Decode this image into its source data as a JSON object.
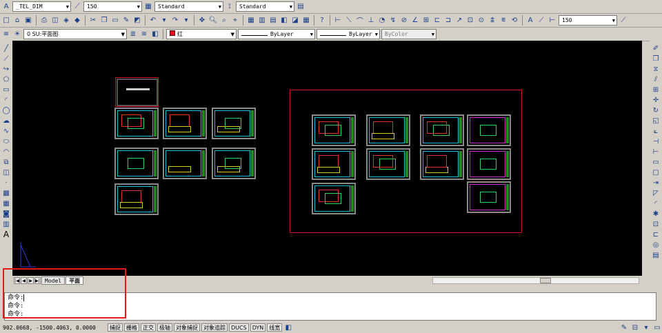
{
  "toolbar1": {
    "dimstyle": "_TEL_DIM",
    "scale": "150",
    "textstyle": "Standard",
    "tablestyle": "Standard"
  },
  "toolbar2": {
    "scale": "150"
  },
  "toolbar3": {
    "layer": "0  SU:平面图",
    "color": "红",
    "linetype": "ByLayer",
    "lineweight": "ByLayer",
    "plotstyle": "ByColor"
  },
  "tabs": {
    "model": "Model",
    "layout": "平面"
  },
  "command": {
    "lines": [
      "命令:",
      "命令:",
      "命令:"
    ]
  },
  "status": {
    "coords": "902.0668,  -1500.4063, 0.0000",
    "buttons": [
      "捕捉",
      "栅格",
      "正交",
      "极轴",
      "对象捕捉",
      "对象追踪",
      "DUCS",
      "DYN",
      "线宽"
    ]
  },
  "colors": {
    "accent": "#e21a1a",
    "canvas": "#000000",
    "frame": "#d01020"
  },
  "icons": {
    "draw": [
      "line-icon",
      "xline-icon",
      "pline-icon",
      "polygon-icon",
      "rectangle-icon",
      "arc-icon",
      "circle-icon",
      "revcloud-icon",
      "spline-icon",
      "ellipse-icon",
      "ellipse-arc-icon",
      "insert-block-icon",
      "make-block-icon",
      "point-icon",
      "hatch-icon",
      "gradient-icon",
      "region-icon",
      "table-icon",
      "mtext-icon"
    ],
    "modify": [
      "erase-icon",
      "copy-icon",
      "mirror-icon",
      "offset-icon",
      "array-icon",
      "move-icon",
      "rotate-icon",
      "scale-icon",
      "stretch-icon",
      "trim-icon",
      "extend-icon",
      "break-point-icon",
      "break-icon",
      "join-icon",
      "chamfer-icon",
      "fillet-icon",
      "explode-icon"
    ]
  }
}
